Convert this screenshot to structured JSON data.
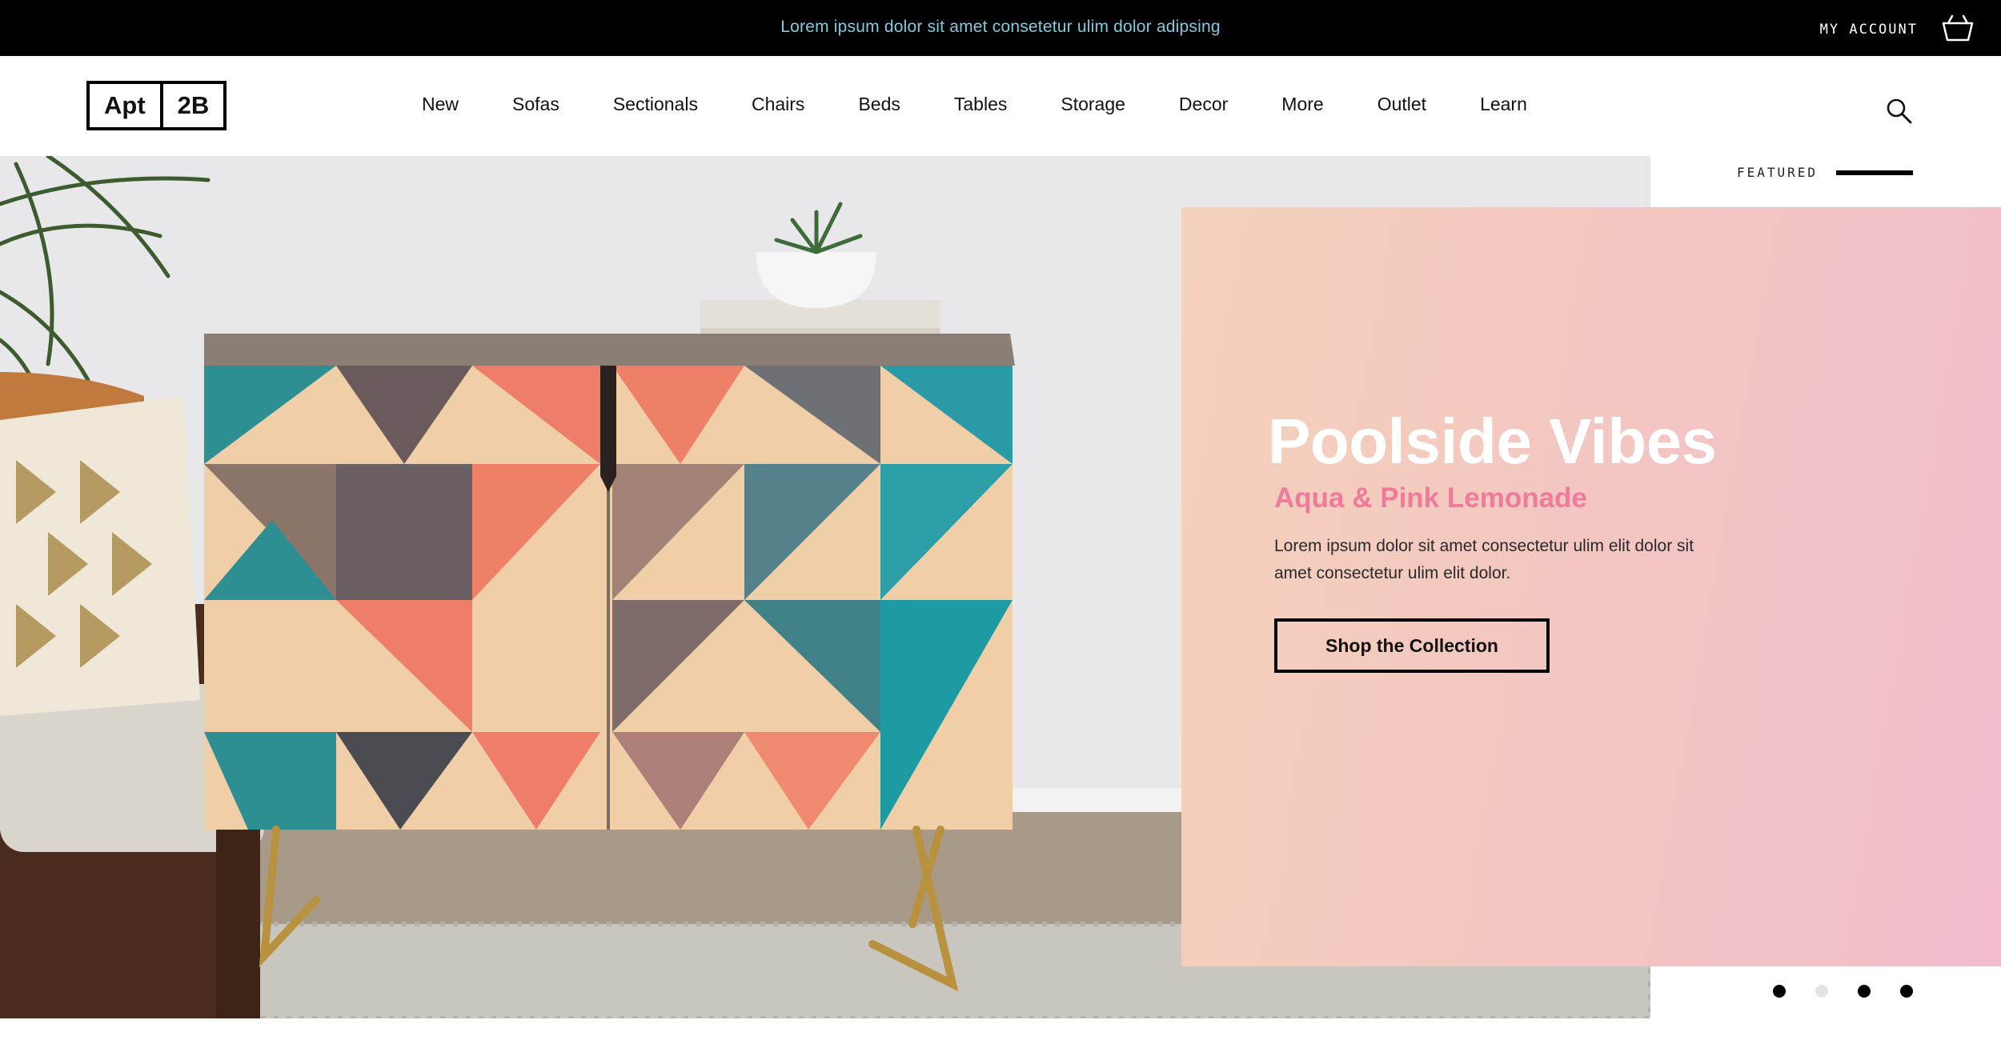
{
  "announcement": "Lorem ipsum dolor sit amet consetetur ulim dolor adipsing",
  "account_label": "MY ACCOUNT",
  "icons": {
    "cart": "basket-icon",
    "search": "search-icon"
  },
  "logo": {
    "part1": "Apt",
    "part2": "2B"
  },
  "nav": [
    "New",
    "Sofas",
    "Sectionals",
    "Chairs",
    "Beds",
    "Tables",
    "Storage",
    "Decor",
    "More",
    "Outlet",
    "Learn"
  ],
  "featured_label": "FEATURED",
  "promo": {
    "title": "Poolside Vibes",
    "subtitle": "Aqua & Pink Lemonade",
    "body": "Lorem ipsum dolor sit amet consectetur ulim elit dolor sit amet consectetur ulim elit dolor.",
    "cta": "Shop the Collection"
  },
  "carousel": {
    "slides": 4,
    "active_index": 1
  },
  "colors": {
    "announcement_text": "#7fcbe0",
    "subtitle": "#ef7a9a",
    "promo_start": "#f5d2bb",
    "promo_end": "#f2bccb"
  }
}
